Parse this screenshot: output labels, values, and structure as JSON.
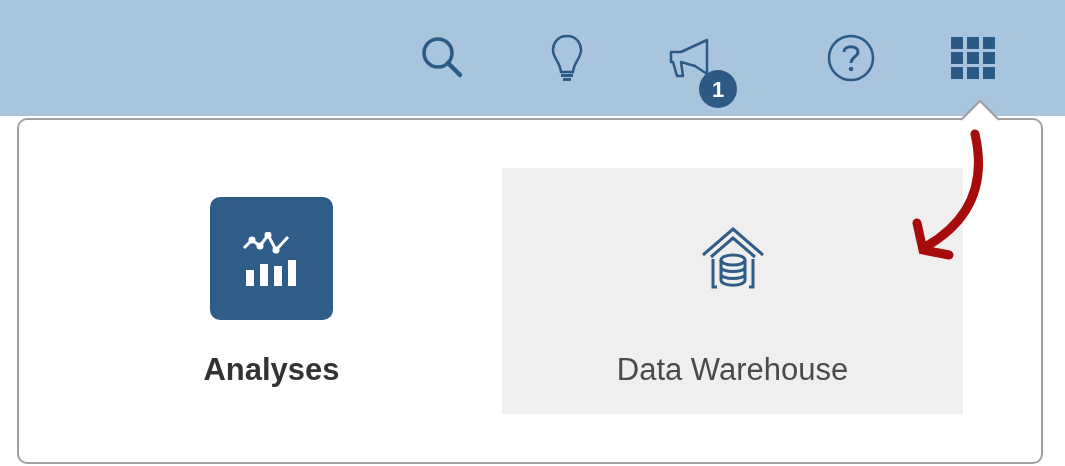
{
  "toolbar": {
    "notification_badge": "1"
  },
  "tiles": [
    {
      "kind": "analytics",
      "label": "Analyses",
      "current": true,
      "selected": false
    },
    {
      "kind": "warehouse",
      "label": "Data Warehouse",
      "current": false,
      "selected": true
    }
  ]
}
